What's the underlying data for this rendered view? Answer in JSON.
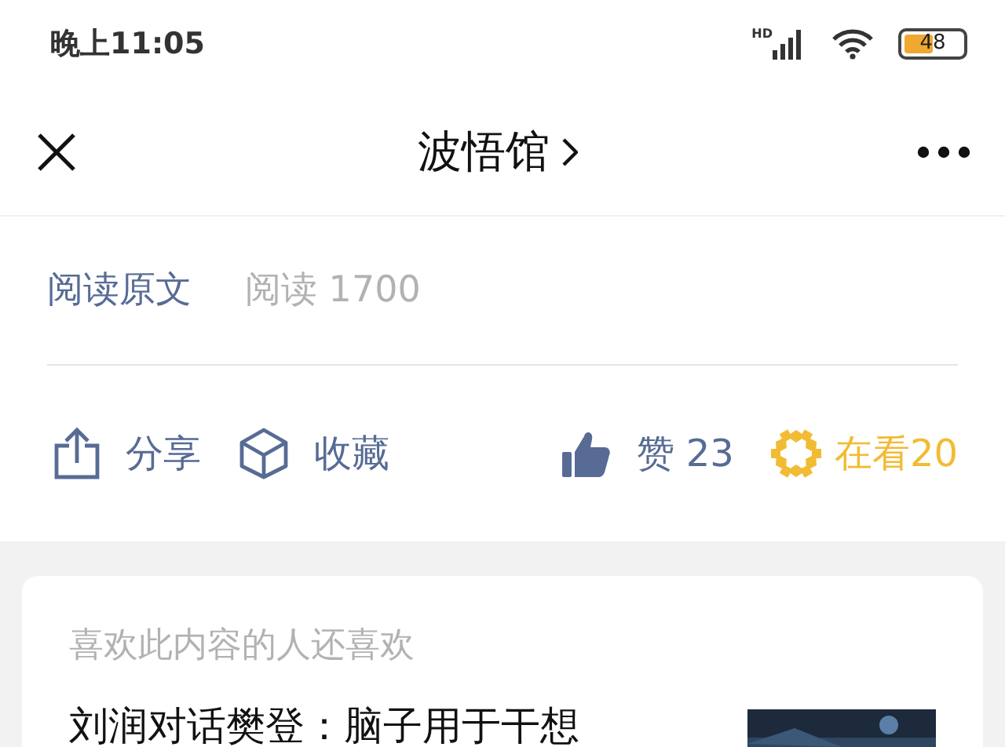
{
  "status_bar": {
    "time": "晚上11:05",
    "network": "HD",
    "battery": "48"
  },
  "header": {
    "title": "波悟馆"
  },
  "article_footer": {
    "read_original": "阅读原文",
    "read_label": "阅读",
    "read_count": "1700"
  },
  "actions": [
    {
      "kind": "share",
      "label": "分享"
    },
    {
      "kind": "collect",
      "label": "收藏"
    },
    {
      "kind": "like",
      "label": "赞",
      "count": "23"
    },
    {
      "kind": "watching",
      "label": "在看",
      "count": "20"
    }
  ],
  "recommendations": {
    "heading": "喜欢此内容的人还喜欢",
    "items": [
      {
        "title": "刘润对话樊登：脑子用于干想",
        "kind": "picture"
      }
    ]
  }
}
